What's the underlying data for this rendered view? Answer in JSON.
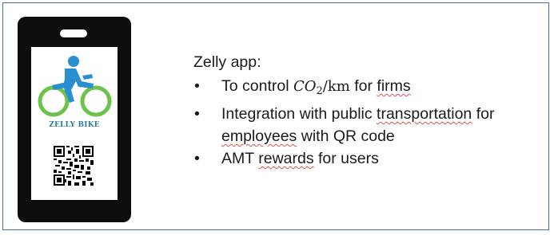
{
  "app": {
    "brand": "ZELLY BIKE",
    "colors": {
      "frame_border": "#4a6fa5",
      "phone_body": "#0d0d0d",
      "rider": "#2a8fcf",
      "wheels": "#6cc24a",
      "brand_text": "#2e7d9a"
    }
  },
  "content": {
    "title": "Zelly app:",
    "bullet1": {
      "pre": "To control ",
      "co": "CO",
      "sub": "2",
      "unit": "/km",
      "mid": " for ",
      "tail": "firms"
    },
    "bullet2": {
      "line1_a": "Integration with public ",
      "line1_b": "transportation",
      "line1_c": " for",
      "line2_a": "employees",
      "line2_b": " with QR code"
    },
    "bullet3": {
      "a": "AMT ",
      "b": "rewards",
      "c": " for users"
    }
  }
}
